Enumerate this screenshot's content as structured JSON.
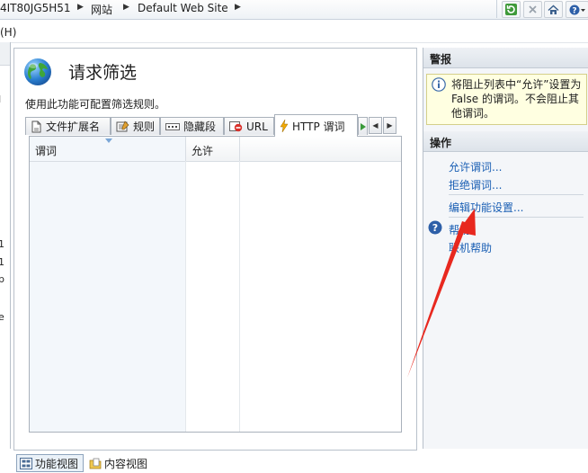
{
  "breadcrumb": {
    "items": [
      "4IT80JG5H51",
      "网站",
      "Default Web Site"
    ]
  },
  "menubar": {
    "help_fragment": "(H)"
  },
  "tree": {
    "fragments": [
      "I",
      "1",
      "1",
      "p",
      "e"
    ]
  },
  "feature": {
    "title": "请求筛选",
    "description": "使用此功能可配置筛选规则。",
    "tabs": [
      {
        "label": "文件扩展名",
        "icon": "file-extension-icon"
      },
      {
        "label": "规则",
        "icon": "rules-icon"
      },
      {
        "label": "隐藏段",
        "icon": "hidden-segments-icon"
      },
      {
        "label": "URL",
        "icon": "url-deny-icon"
      },
      {
        "label": "HTTP 谓词",
        "icon": "http-verb-icon",
        "active": true
      }
    ],
    "grid": {
      "columns": [
        "谓词",
        "允许"
      ],
      "rows": []
    }
  },
  "viewtabs": {
    "features_view": "功能视图",
    "content_view": "内容视图"
  },
  "actions": {
    "alerts_header": "警报",
    "alert_text": "将阻止列表中“允许”设置为 False 的谓词。不会阻止其他谓词。",
    "actions_header": "操作",
    "allow_verb": "允许谓词...",
    "deny_verb": "拒绝谓词...",
    "edit_feature_settings": "编辑功能设置...",
    "help": "帮助",
    "online_help": "联机帮助"
  },
  "colors": {
    "link": "#1a5fb4",
    "annotation_arrow": "#e8281f",
    "alert_background": "#ffffe1"
  }
}
